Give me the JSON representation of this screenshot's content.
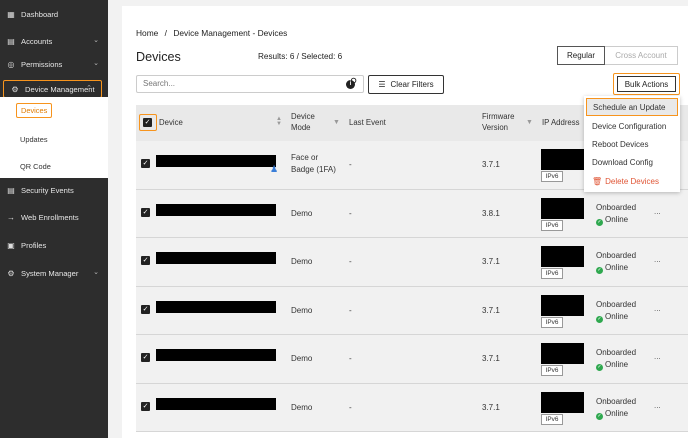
{
  "sidebar": {
    "items": [
      {
        "label": "Dashboard",
        "icon": "chart-icon"
      },
      {
        "label": "Accounts",
        "icon": "accounts-icon"
      },
      {
        "label": "Permissions",
        "icon": "permissions-icon"
      },
      {
        "label": "Device Management",
        "icon": "gear-icon"
      },
      {
        "label": "Security Events",
        "icon": "security-events-icon"
      },
      {
        "label": "Web Enrollments",
        "icon": "enrollment-icon"
      },
      {
        "label": "Profiles",
        "icon": "profiles-icon"
      },
      {
        "label": "System Manager",
        "icon": "system-manager-icon"
      }
    ],
    "submenu": [
      "Devices",
      "Updates",
      "QR Code"
    ]
  },
  "breadcrumb": {
    "home": "Home",
    "separator": "/",
    "current": "Device Management - Devices"
  },
  "page": {
    "title": "Devices",
    "results": "Results: 6 / Selected: 6"
  },
  "view_toggle": {
    "regular": "Regular",
    "cross": "Cross Account"
  },
  "search": {
    "placeholder": "Search..."
  },
  "toolbar": {
    "clear_filters": "Clear Filters",
    "bulk_actions": "Bulk Actions"
  },
  "table": {
    "headers": {
      "device": "Device",
      "mode_line1": "Device",
      "mode_line2": "Mode",
      "last_event": "Last Event",
      "fw_line1": "Firmware",
      "fw_line2": "Version",
      "ip": "IP Address"
    },
    "rows": [
      {
        "mode_line1": "Face or",
        "mode_line2": "Badge (1FA)",
        "event": "-",
        "fw": "3.7.1",
        "ipv6": "IPv6",
        "status": "",
        "online": ""
      },
      {
        "mode_line1": "Demo",
        "mode_line2": "",
        "event": "-",
        "fw": "3.8.1",
        "ipv6": "IPv6",
        "status": "Onboarded",
        "online": "Online"
      },
      {
        "mode_line1": "Demo",
        "mode_line2": "",
        "event": "-",
        "fw": "3.7.1",
        "ipv6": "IPv6",
        "status": "Onboarded",
        "online": "Online"
      },
      {
        "mode_line1": "Demo",
        "mode_line2": "",
        "event": "-",
        "fw": "3.7.1",
        "ipv6": "IPv6",
        "status": "Onboarded",
        "online": "Online"
      },
      {
        "mode_line1": "Demo",
        "mode_line2": "",
        "event": "-",
        "fw": "3.7.1",
        "ipv6": "IPv6",
        "status": "Onboarded",
        "online": "Online"
      },
      {
        "mode_line1": "Demo",
        "mode_line2": "",
        "event": "-",
        "fw": "3.7.1",
        "ipv6": "IPv6",
        "status": "Onboarded",
        "online": "Online"
      }
    ],
    "more": "..."
  },
  "bulk_menu": {
    "items": [
      "Schedule an Update",
      "Device Configuration",
      "Reboot Devices",
      "Download Config",
      "Delete Devices"
    ]
  },
  "colors": {
    "accent": "#f7941d",
    "sidebar": "#2d2d2d",
    "online": "#2fa84f",
    "danger": "#e05535"
  }
}
